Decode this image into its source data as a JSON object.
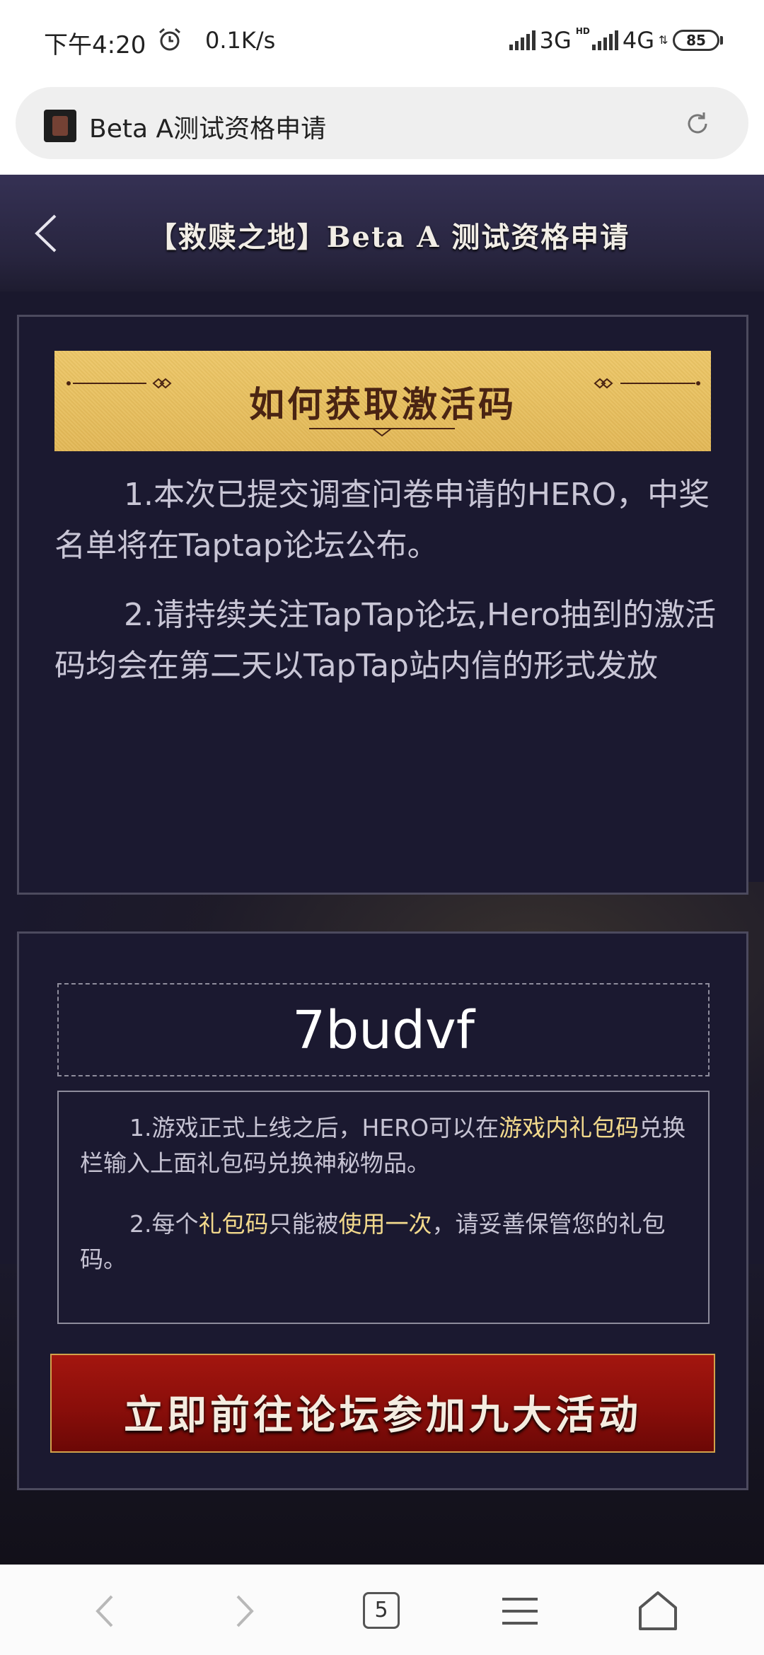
{
  "status_bar": {
    "time": "下午4:20",
    "speed": "0.1K/s",
    "net1": "3G",
    "hd": "HD",
    "net2": "4G",
    "battery": "85",
    "alarm_icon": "alarm-clock-icon"
  },
  "browser": {
    "page_title": "Beta A测试资格申请",
    "favicon": "game-favicon",
    "refresh_icon": "refresh-icon"
  },
  "header": {
    "title": "【救赎之地】Beta A 测试资格申请",
    "back_icon": "chevron-left-icon"
  },
  "section1": {
    "banner_title": "如何获取激活码",
    "paragraphs": [
      "1.本次已提交调查问卷申请的HERO，中奖名单将在Taptap论坛公布。",
      "2.请持续关注TapTap论坛,Hero抽到的激活码均会在第二天以TapTap站内信的形式发放"
    ]
  },
  "section2": {
    "code": "7budvf",
    "note1": {
      "a": "1.游戏正式上线之后，HERO可以在",
      "b": "游戏内礼包码",
      "c": "兑换栏输入上面礼包码兑换神秘物品。"
    },
    "note2": {
      "a": "2.每个",
      "b": "礼包码",
      "c": "只能被",
      "d": "使用一次",
      "e": "，请妥善保管您的礼包码。"
    },
    "cta_label": "立即前往论坛参加九大活动"
  },
  "bottom_nav": {
    "tab_count": "5",
    "icons": [
      "back-arrow-icon",
      "forward-arrow-icon",
      "tabs-icon",
      "menu-icon",
      "home-icon"
    ]
  },
  "colors": {
    "page_bg": "#1a182d",
    "banner_gold": "#e4b955",
    "highlight": "#f2d98c",
    "cta_red": "#8a0e0a"
  }
}
